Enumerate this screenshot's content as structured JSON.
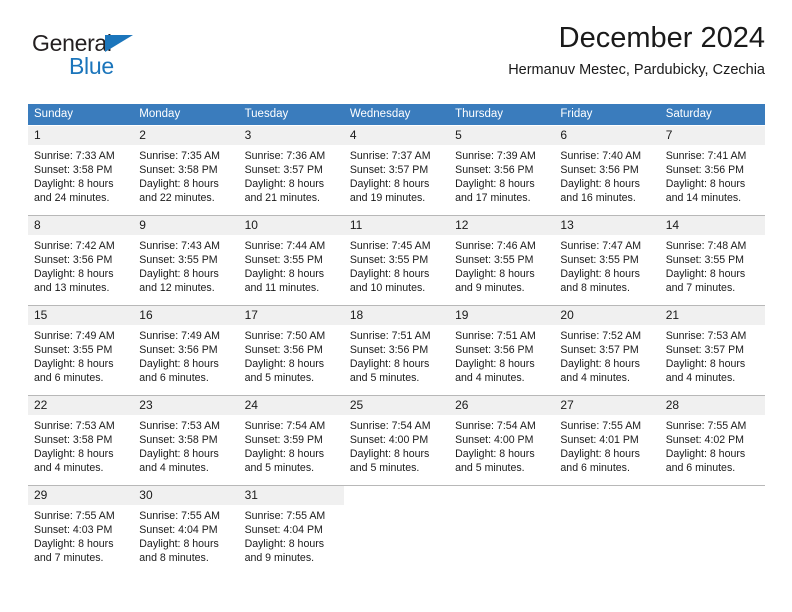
{
  "logo": {
    "word1": "General",
    "word2": "Blue",
    "triangle_color": "#1b75bb",
    "word2_color": "#1b75bb",
    "word1_color": "#231f20"
  },
  "header": {
    "title": "December 2024",
    "subtitle": "Hermanuv Mestec, Pardubicky, Czechia"
  },
  "colors": {
    "header_row": "#3a7cbd",
    "day_band": "#f0f0f0",
    "week_separator": "#b8b8b8",
    "text": "#1a1a1a"
  },
  "weekdays": [
    "Sunday",
    "Monday",
    "Tuesday",
    "Wednesday",
    "Thursday",
    "Friday",
    "Saturday"
  ],
  "weeks": [
    [
      {
        "day": "1",
        "sunrise": "Sunrise: 7:33 AM",
        "sunset": "Sunset: 3:58 PM",
        "daylight1": "Daylight: 8 hours",
        "daylight2": "and 24 minutes."
      },
      {
        "day": "2",
        "sunrise": "Sunrise: 7:35 AM",
        "sunset": "Sunset: 3:58 PM",
        "daylight1": "Daylight: 8 hours",
        "daylight2": "and 22 minutes."
      },
      {
        "day": "3",
        "sunrise": "Sunrise: 7:36 AM",
        "sunset": "Sunset: 3:57 PM",
        "daylight1": "Daylight: 8 hours",
        "daylight2": "and 21 minutes."
      },
      {
        "day": "4",
        "sunrise": "Sunrise: 7:37 AM",
        "sunset": "Sunset: 3:57 PM",
        "daylight1": "Daylight: 8 hours",
        "daylight2": "and 19 minutes."
      },
      {
        "day": "5",
        "sunrise": "Sunrise: 7:39 AM",
        "sunset": "Sunset: 3:56 PM",
        "daylight1": "Daylight: 8 hours",
        "daylight2": "and 17 minutes."
      },
      {
        "day": "6",
        "sunrise": "Sunrise: 7:40 AM",
        "sunset": "Sunset: 3:56 PM",
        "daylight1": "Daylight: 8 hours",
        "daylight2": "and 16 minutes."
      },
      {
        "day": "7",
        "sunrise": "Sunrise: 7:41 AM",
        "sunset": "Sunset: 3:56 PM",
        "daylight1": "Daylight: 8 hours",
        "daylight2": "and 14 minutes."
      }
    ],
    [
      {
        "day": "8",
        "sunrise": "Sunrise: 7:42 AM",
        "sunset": "Sunset: 3:56 PM",
        "daylight1": "Daylight: 8 hours",
        "daylight2": "and 13 minutes."
      },
      {
        "day": "9",
        "sunrise": "Sunrise: 7:43 AM",
        "sunset": "Sunset: 3:55 PM",
        "daylight1": "Daylight: 8 hours",
        "daylight2": "and 12 minutes."
      },
      {
        "day": "10",
        "sunrise": "Sunrise: 7:44 AM",
        "sunset": "Sunset: 3:55 PM",
        "daylight1": "Daylight: 8 hours",
        "daylight2": "and 11 minutes."
      },
      {
        "day": "11",
        "sunrise": "Sunrise: 7:45 AM",
        "sunset": "Sunset: 3:55 PM",
        "daylight1": "Daylight: 8 hours",
        "daylight2": "and 10 minutes."
      },
      {
        "day": "12",
        "sunrise": "Sunrise: 7:46 AM",
        "sunset": "Sunset: 3:55 PM",
        "daylight1": "Daylight: 8 hours",
        "daylight2": "and 9 minutes."
      },
      {
        "day": "13",
        "sunrise": "Sunrise: 7:47 AM",
        "sunset": "Sunset: 3:55 PM",
        "daylight1": "Daylight: 8 hours",
        "daylight2": "and 8 minutes."
      },
      {
        "day": "14",
        "sunrise": "Sunrise: 7:48 AM",
        "sunset": "Sunset: 3:55 PM",
        "daylight1": "Daylight: 8 hours",
        "daylight2": "and 7 minutes."
      }
    ],
    [
      {
        "day": "15",
        "sunrise": "Sunrise: 7:49 AM",
        "sunset": "Sunset: 3:55 PM",
        "daylight1": "Daylight: 8 hours",
        "daylight2": "and 6 minutes."
      },
      {
        "day": "16",
        "sunrise": "Sunrise: 7:49 AM",
        "sunset": "Sunset: 3:56 PM",
        "daylight1": "Daylight: 8 hours",
        "daylight2": "and 6 minutes."
      },
      {
        "day": "17",
        "sunrise": "Sunrise: 7:50 AM",
        "sunset": "Sunset: 3:56 PM",
        "daylight1": "Daylight: 8 hours",
        "daylight2": "and 5 minutes."
      },
      {
        "day": "18",
        "sunrise": "Sunrise: 7:51 AM",
        "sunset": "Sunset: 3:56 PM",
        "daylight1": "Daylight: 8 hours",
        "daylight2": "and 5 minutes."
      },
      {
        "day": "19",
        "sunrise": "Sunrise: 7:51 AM",
        "sunset": "Sunset: 3:56 PM",
        "daylight1": "Daylight: 8 hours",
        "daylight2": "and 4 minutes."
      },
      {
        "day": "20",
        "sunrise": "Sunrise: 7:52 AM",
        "sunset": "Sunset: 3:57 PM",
        "daylight1": "Daylight: 8 hours",
        "daylight2": "and 4 minutes."
      },
      {
        "day": "21",
        "sunrise": "Sunrise: 7:53 AM",
        "sunset": "Sunset: 3:57 PM",
        "daylight1": "Daylight: 8 hours",
        "daylight2": "and 4 minutes."
      }
    ],
    [
      {
        "day": "22",
        "sunrise": "Sunrise: 7:53 AM",
        "sunset": "Sunset: 3:58 PM",
        "daylight1": "Daylight: 8 hours",
        "daylight2": "and 4 minutes."
      },
      {
        "day": "23",
        "sunrise": "Sunrise: 7:53 AM",
        "sunset": "Sunset: 3:58 PM",
        "daylight1": "Daylight: 8 hours",
        "daylight2": "and 4 minutes."
      },
      {
        "day": "24",
        "sunrise": "Sunrise: 7:54 AM",
        "sunset": "Sunset: 3:59 PM",
        "daylight1": "Daylight: 8 hours",
        "daylight2": "and 5 minutes."
      },
      {
        "day": "25",
        "sunrise": "Sunrise: 7:54 AM",
        "sunset": "Sunset: 4:00 PM",
        "daylight1": "Daylight: 8 hours",
        "daylight2": "and 5 minutes."
      },
      {
        "day": "26",
        "sunrise": "Sunrise: 7:54 AM",
        "sunset": "Sunset: 4:00 PM",
        "daylight1": "Daylight: 8 hours",
        "daylight2": "and 5 minutes."
      },
      {
        "day": "27",
        "sunrise": "Sunrise: 7:55 AM",
        "sunset": "Sunset: 4:01 PM",
        "daylight1": "Daylight: 8 hours",
        "daylight2": "and 6 minutes."
      },
      {
        "day": "28",
        "sunrise": "Sunrise: 7:55 AM",
        "sunset": "Sunset: 4:02 PM",
        "daylight1": "Daylight: 8 hours",
        "daylight2": "and 6 minutes."
      }
    ],
    [
      {
        "day": "29",
        "sunrise": "Sunrise: 7:55 AM",
        "sunset": "Sunset: 4:03 PM",
        "daylight1": "Daylight: 8 hours",
        "daylight2": "and 7 minutes."
      },
      {
        "day": "30",
        "sunrise": "Sunrise: 7:55 AM",
        "sunset": "Sunset: 4:04 PM",
        "daylight1": "Daylight: 8 hours",
        "daylight2": "and 8 minutes."
      },
      {
        "day": "31",
        "sunrise": "Sunrise: 7:55 AM",
        "sunset": "Sunset: 4:04 PM",
        "daylight1": "Daylight: 8 hours",
        "daylight2": "and 9 minutes."
      },
      {
        "day": "",
        "sunrise": "",
        "sunset": "",
        "daylight1": "",
        "daylight2": ""
      },
      {
        "day": "",
        "sunrise": "",
        "sunset": "",
        "daylight1": "",
        "daylight2": ""
      },
      {
        "day": "",
        "sunrise": "",
        "sunset": "",
        "daylight1": "",
        "daylight2": ""
      },
      {
        "day": "",
        "sunrise": "",
        "sunset": "",
        "daylight1": "",
        "daylight2": ""
      }
    ]
  ]
}
